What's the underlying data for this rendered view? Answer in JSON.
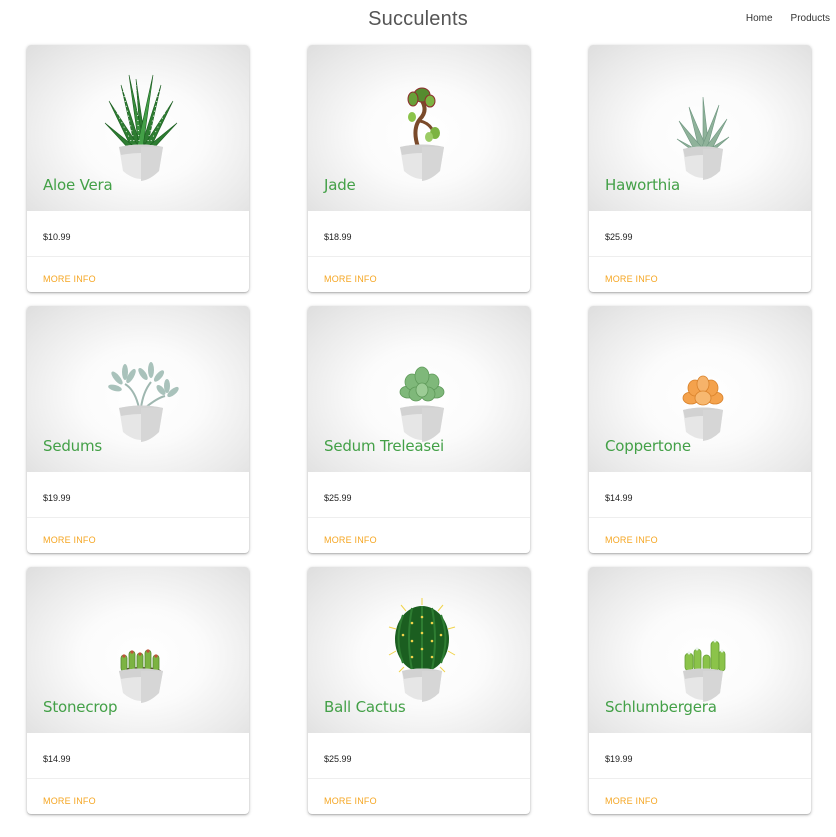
{
  "header": {
    "title": "Succulents"
  },
  "nav": {
    "items": [
      "Home",
      "Products"
    ]
  },
  "products": [
    {
      "name": "Aloe Vera",
      "price": "$10.99",
      "action": "MORE INFO",
      "icon": "aloe-vera-plant-icon"
    },
    {
      "name": "Jade",
      "price": "$18.99",
      "action": "MORE INFO",
      "icon": "jade-plant-icon"
    },
    {
      "name": "Haworthia",
      "price": "$25.99",
      "action": "MORE INFO",
      "icon": "haworthia-plant-icon"
    },
    {
      "name": "Sedums",
      "price": "$19.99",
      "action": "MORE INFO",
      "icon": "sedums-plant-icon"
    },
    {
      "name": "Sedum Treleasei",
      "price": "$25.99",
      "action": "MORE INFO",
      "icon": "sedum-treleasei-plant-icon"
    },
    {
      "name": "Coppertone",
      "price": "$14.99",
      "action": "MORE INFO",
      "icon": "coppertone-plant-icon"
    },
    {
      "name": "Stonecrop",
      "price": "$14.99",
      "action": "MORE INFO",
      "icon": "stonecrop-plant-icon"
    },
    {
      "name": "Ball Cactus",
      "price": "$25.99",
      "action": "MORE INFO",
      "icon": "ball-cactus-plant-icon"
    },
    {
      "name": "Schlumbergera",
      "price": "$19.99",
      "action": "MORE INFO",
      "icon": "schlumbergera-plant-icon"
    }
  ],
  "colors": {
    "name_green": "#43a047",
    "action_orange": "#f5a623",
    "pot": "#e4e4e4"
  }
}
